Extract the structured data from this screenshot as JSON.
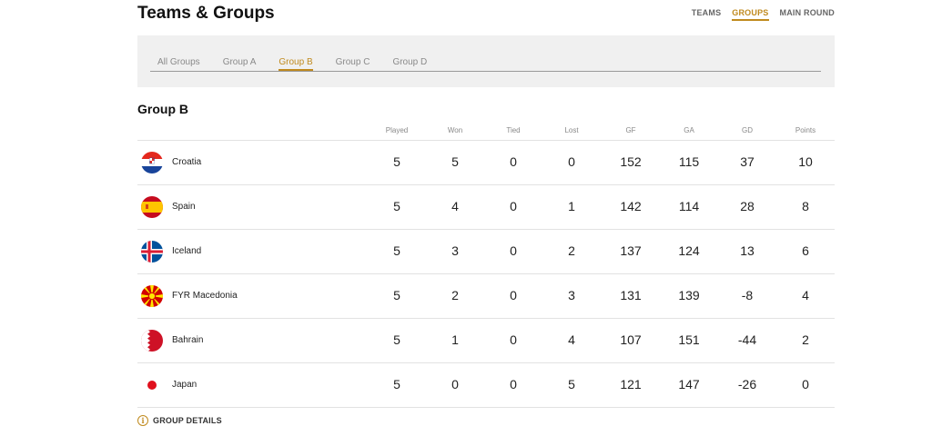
{
  "header": {
    "title": "Teams & Groups",
    "nav": [
      "TEAMS",
      "GROUPS",
      "MAIN ROUND"
    ],
    "active_nav": "GROUPS"
  },
  "tabs": {
    "items": [
      "All Groups",
      "Group A",
      "Group B",
      "Group C",
      "Group D"
    ],
    "active": "Group B"
  },
  "group": {
    "heading": "Group B",
    "columns": [
      "Played",
      "Won",
      "Tied",
      "Lost",
      "GF",
      "GA",
      "GD",
      "Points"
    ],
    "rows": [
      {
        "team": "Croatia",
        "flag": "croatia-flag-icon",
        "stats": [
          "5",
          "5",
          "0",
          "0",
          "152",
          "115",
          "37",
          "10"
        ]
      },
      {
        "team": "Spain",
        "flag": "spain-flag-icon",
        "stats": [
          "5",
          "4",
          "0",
          "1",
          "142",
          "114",
          "28",
          "8"
        ]
      },
      {
        "team": "Iceland",
        "flag": "iceland-flag-icon",
        "stats": [
          "5",
          "3",
          "0",
          "2",
          "137",
          "124",
          "13",
          "6"
        ]
      },
      {
        "team": "FYR Macedonia",
        "flag": "macedonia-flag-icon",
        "stats": [
          "5",
          "2",
          "0",
          "3",
          "131",
          "139",
          "-8",
          "4"
        ]
      },
      {
        "team": "Bahrain",
        "flag": "bahrain-flag-icon",
        "stats": [
          "5",
          "1",
          "0",
          "4",
          "107",
          "151",
          "-44",
          "2"
        ]
      },
      {
        "team": "Japan",
        "flag": "japan-flag-icon",
        "stats": [
          "5",
          "0",
          "0",
          "5",
          "121",
          "147",
          "-26",
          "0"
        ]
      }
    ]
  },
  "footer": {
    "details_label": "GROUP DETAILS",
    "icon": "info-icon"
  },
  "colors": {
    "accent": "#c08a1e",
    "panel_bg": "#f0f0f0",
    "divider": "#e2e2e2"
  }
}
